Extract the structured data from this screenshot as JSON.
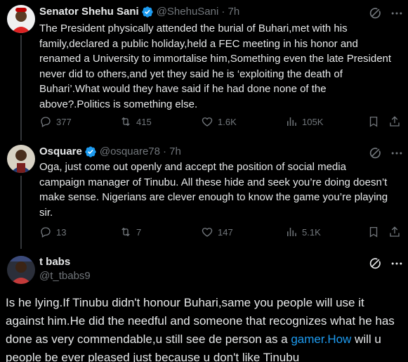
{
  "post1": {
    "name": "Senator Shehu Sani",
    "handle": "@ShehuSani",
    "time": "· 7h",
    "text": "The President physically attended the burial of Buhari,met with his family,declared a public holiday,held a FEC meeting in his honor and renamed a University to immortalise him,Something even the late President never did to others,and yet they said he is ‘exploiting the death of Buhari’.What would they have said if he had done none of the above?.Politics is something else.",
    "replies": "377",
    "reposts": "415",
    "likes": "1.6K",
    "views": "105K"
  },
  "post2": {
    "name": "Osquare",
    "handle": "@osquare78",
    "time": "· 7h",
    "text": "Oga, just come out openly and accept the position of social media campaign manager of Tinubu. All these hide and seek you’re doing doesn’t make sense. Nigerians are clever enough to know the game you’re playing sir.",
    "replies": "13",
    "reposts": "7",
    "likes": "147",
    "views": "5.1K"
  },
  "post3": {
    "name": "t babs",
    "handle": "@t_tbabs9",
    "text_before": "Is he lying.If Tinubu didn't honour Buhari,same you people will use it against him.He did the needful and someone that recognizes what he has done as very commendable,u still see de person as a ",
    "link": "gamer.How",
    "text_after": " will u people be ever pleased just because u don't like Tinubu"
  },
  "colors": {
    "background": "#000000",
    "text": "#e7e9ea",
    "muted": "#71767b",
    "accent": "#1d9bf0",
    "verified": "#1d9bf0"
  },
  "icons": [
    "verified-badge-icon",
    "grok-icon",
    "more-icon",
    "reply-icon",
    "repost-icon",
    "like-icon",
    "views-icon",
    "bookmark-icon",
    "share-icon"
  ]
}
